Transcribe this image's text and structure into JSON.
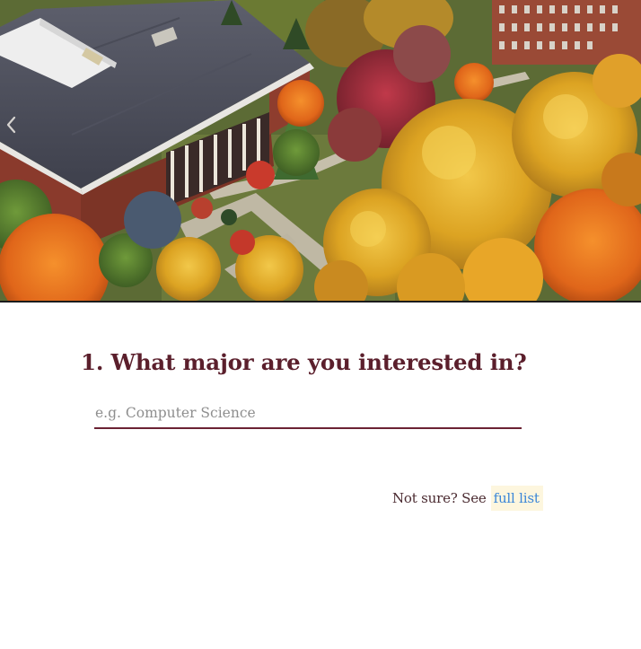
{
  "hero": {
    "icons": {
      "prev": "chevron-left-icon"
    }
  },
  "question": {
    "number_title": "1. What major are you interested in?",
    "input_value": "",
    "input_placeholder": "e.g. Computer Science"
  },
  "help": {
    "text": "Not sure? See",
    "link_label": "full list"
  },
  "colors": {
    "title": "#5b1f2c",
    "input_underline": "#6b2233",
    "link": "#3a86d8",
    "link_highlight": "#fdf6de"
  }
}
